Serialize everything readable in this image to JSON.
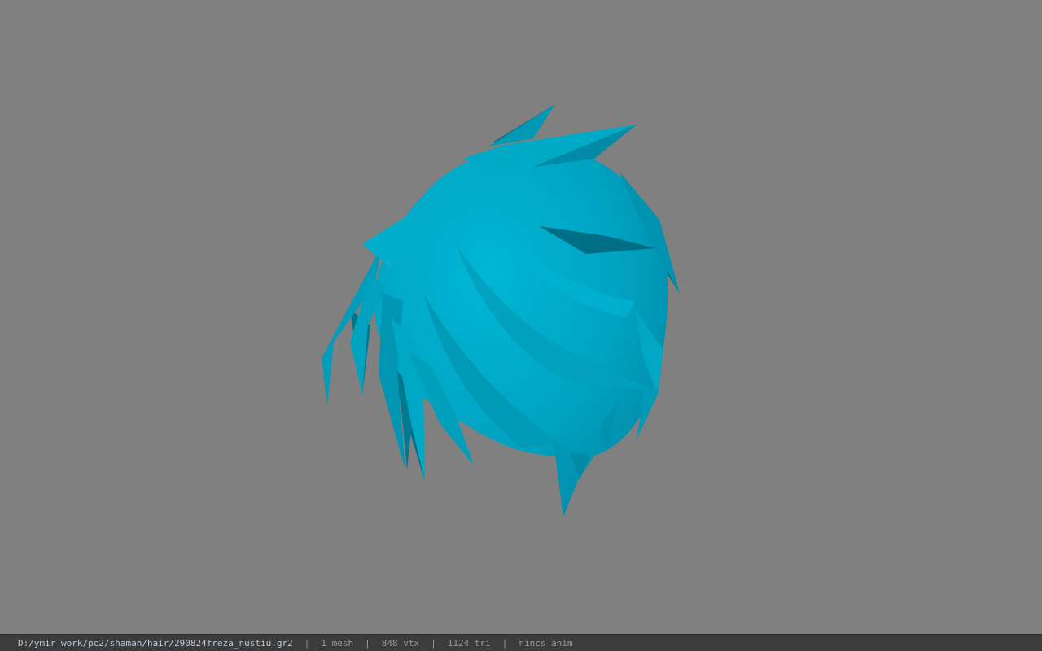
{
  "viewport": {
    "background_color": "#808080",
    "model": "hair-mesh",
    "mesh_color": "#00a7c6"
  },
  "status_bar": {
    "file_path": "D:/ymir work/pc2/shaman/hair/290824freza_nustiu.gr2",
    "separator": "|",
    "mesh_count": "1 mesh",
    "vertex_count": "848 vtx",
    "triangle_count": "1124 tri",
    "animation": "nincs anim"
  }
}
